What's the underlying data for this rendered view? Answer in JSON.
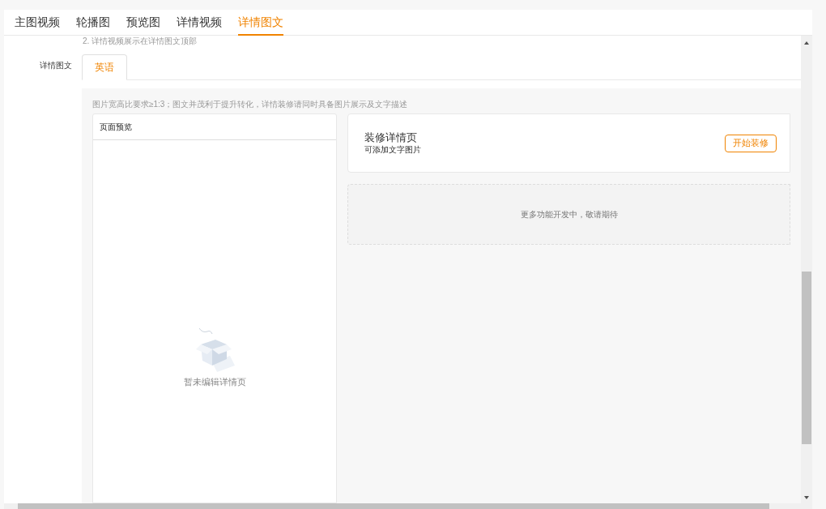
{
  "tabs": [
    {
      "label": "主图视频",
      "selected": false
    },
    {
      "label": "轮播图",
      "selected": false
    },
    {
      "label": "预览图",
      "selected": false
    },
    {
      "label": "详情视频",
      "selected": false
    },
    {
      "label": "详情图文",
      "selected": true
    }
  ],
  "note": "2. 详情视频展示在详情图文顶部",
  "field_label": "详情图文",
  "language_tabs": [
    {
      "label": "英语",
      "selected": true
    }
  ],
  "hint": "图片宽高比要求≥1:3；图文并茂利于提升转化，详情装修请同时具备图片展示及文字描述",
  "preview": {
    "title": "页面预览",
    "empty_text": "暂未编辑详情页"
  },
  "decorate": {
    "title": "装修详情页",
    "subtitle": "可添加文字图片",
    "button": "开始装修"
  },
  "coming_soon": "更多功能开发中，敬请期待"
}
